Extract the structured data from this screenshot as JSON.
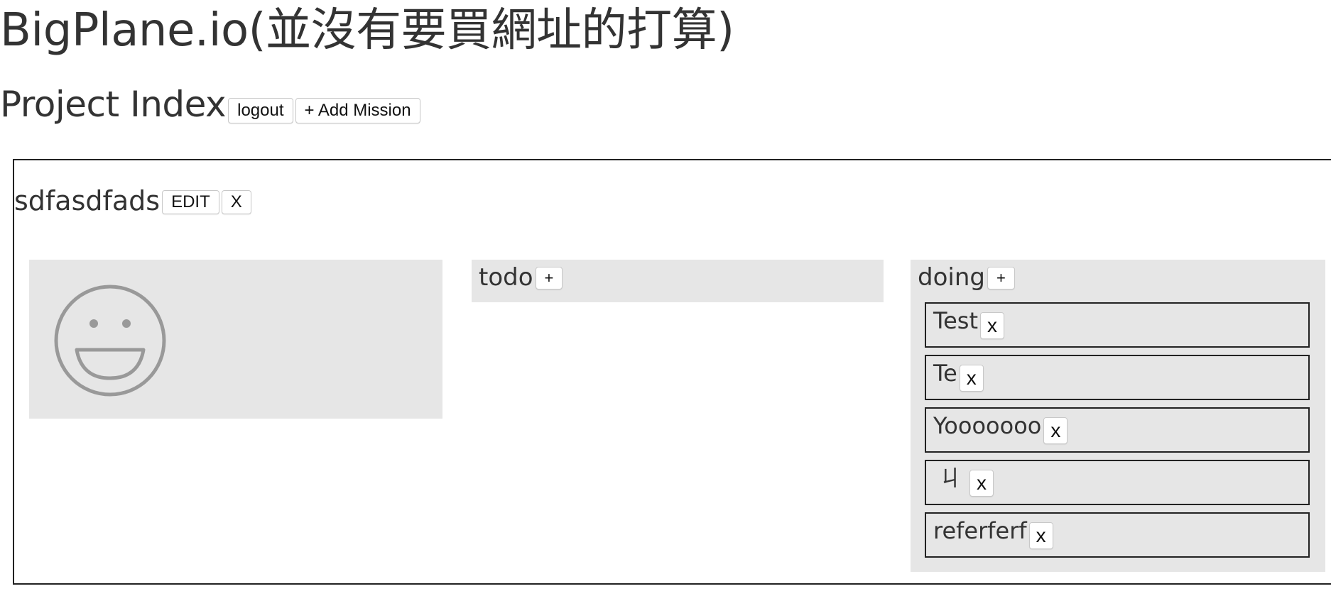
{
  "site": {
    "title": "BigPlane.io(並沒有要買網址的打算)"
  },
  "header": {
    "page_title": "Project Index",
    "logout_label": "logout",
    "add_mission_label": "+ Add Mission"
  },
  "project": {
    "name": "sdfasdfads",
    "edit_label": "EDIT",
    "delete_label": "X",
    "avatar_icon": "smiley-face-icon",
    "columns": {
      "todo": {
        "title": "todo",
        "add_label": "+"
      },
      "doing": {
        "title": "doing",
        "add_label": "+",
        "tasks": [
          {
            "label": "Test",
            "remove_label": "x"
          },
          {
            "label": "Te",
            "remove_label": "x"
          },
          {
            "label": "Yooooooo",
            "remove_label": "x"
          },
          {
            "label": "ㄐ",
            "remove_label": "x"
          },
          {
            "label": "referferf",
            "remove_label": "x"
          }
        ]
      }
    }
  },
  "colors": {
    "panel_bg": "#e6e6e6",
    "text": "#333333",
    "border": "#222222",
    "icon": "#999999"
  }
}
